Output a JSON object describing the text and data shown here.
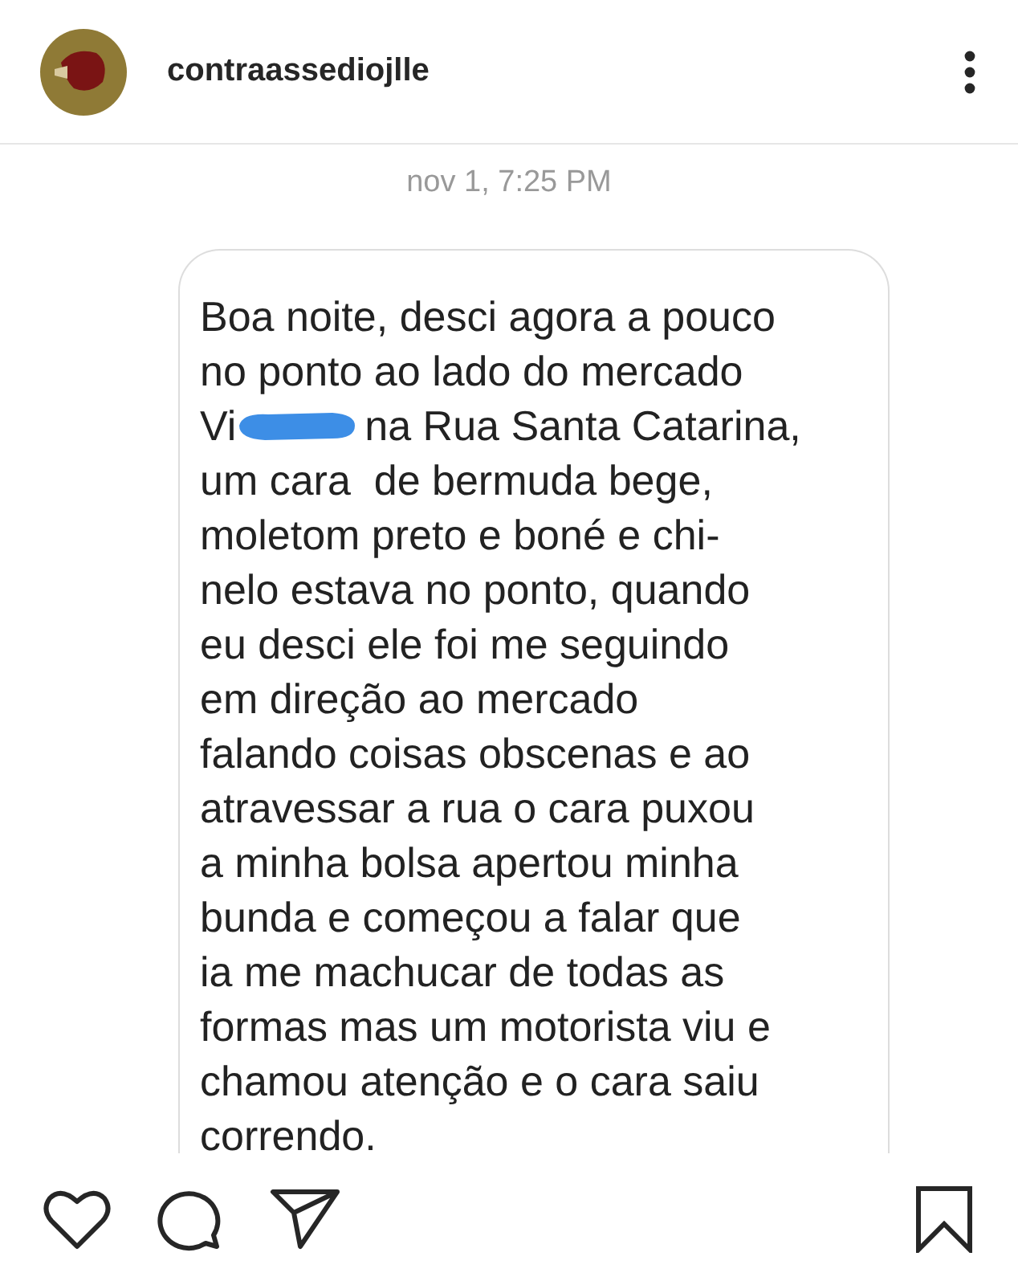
{
  "header": {
    "username": "contraassediojlle"
  },
  "timestamp": "nov 1, 7:25 PM",
  "message_lines": [
    {
      "text": "Boa noite, desci agora a pouco",
      "redacted": false
    },
    {
      "text": "no ponto ao lado do mercado",
      "redacted": false
    },
    {
      "text": "Vi",
      "redacted": true,
      "after": "na Rua Santa Catarina,"
    },
    {
      "text": "um cara  de bermuda bege,",
      "redacted": false
    },
    {
      "text": "moletom preto e boné e chi-",
      "redacted": false
    },
    {
      "text": "nelo estava no ponto, quando",
      "redacted": false
    },
    {
      "text": "eu desci ele foi me seguindo",
      "redacted": false
    },
    {
      "text": "em direção ao mercado",
      "redacted": false
    },
    {
      "text": "falando coisas obscenas e ao",
      "redacted": false
    },
    {
      "text": "atravessar a rua o cara puxou",
      "redacted": false
    },
    {
      "text": "a minha bolsa apertou minha",
      "redacted": false
    },
    {
      "text": "bunda e começou a falar que",
      "redacted": false
    },
    {
      "text": "ia me machucar de todas as",
      "redacted": false
    },
    {
      "text": "formas mas um motorista viu e",
      "redacted": false
    },
    {
      "text": "chamou atenção e o cara saiu",
      "redacted": false
    },
    {
      "text": "correndo.",
      "redacted": false
    }
  ]
}
